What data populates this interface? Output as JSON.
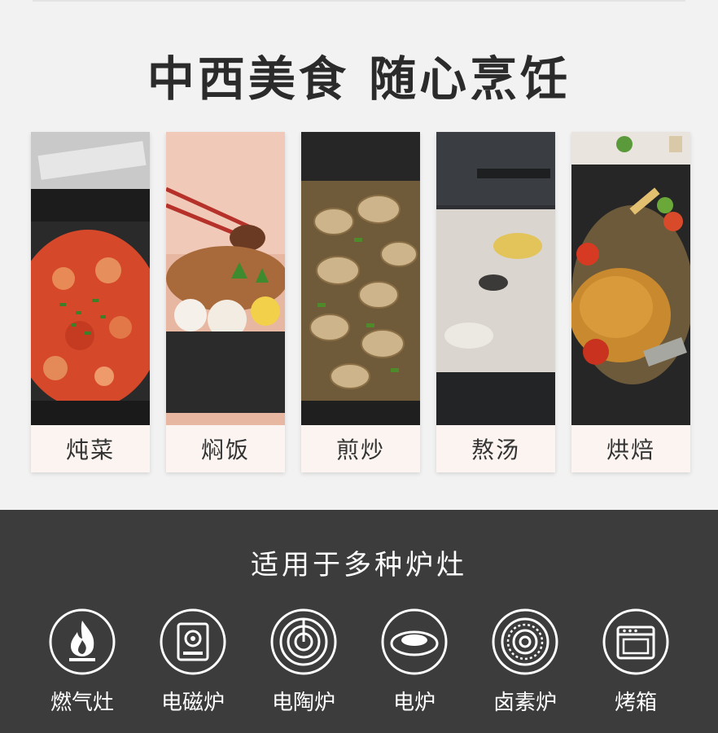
{
  "headline": "中西美食 随心烹饪",
  "dishes": [
    {
      "label": "炖菜"
    },
    {
      "label": "焖饭"
    },
    {
      "label": "煎炒"
    },
    {
      "label": "熬汤"
    },
    {
      "label": "烘焙"
    }
  ],
  "stoves_title": "适用于多种炉灶",
  "stoves": [
    {
      "label": "燃气灶",
      "icon": "flame-icon"
    },
    {
      "label": "电磁炉",
      "icon": "induction-icon"
    },
    {
      "label": "电陶炉",
      "icon": "ceramic-hob-icon"
    },
    {
      "label": "电炉",
      "icon": "electric-stove-icon"
    },
    {
      "label": "卤素炉",
      "icon": "halogen-hob-icon"
    },
    {
      "label": "烤箱",
      "icon": "oven-icon"
    }
  ]
}
